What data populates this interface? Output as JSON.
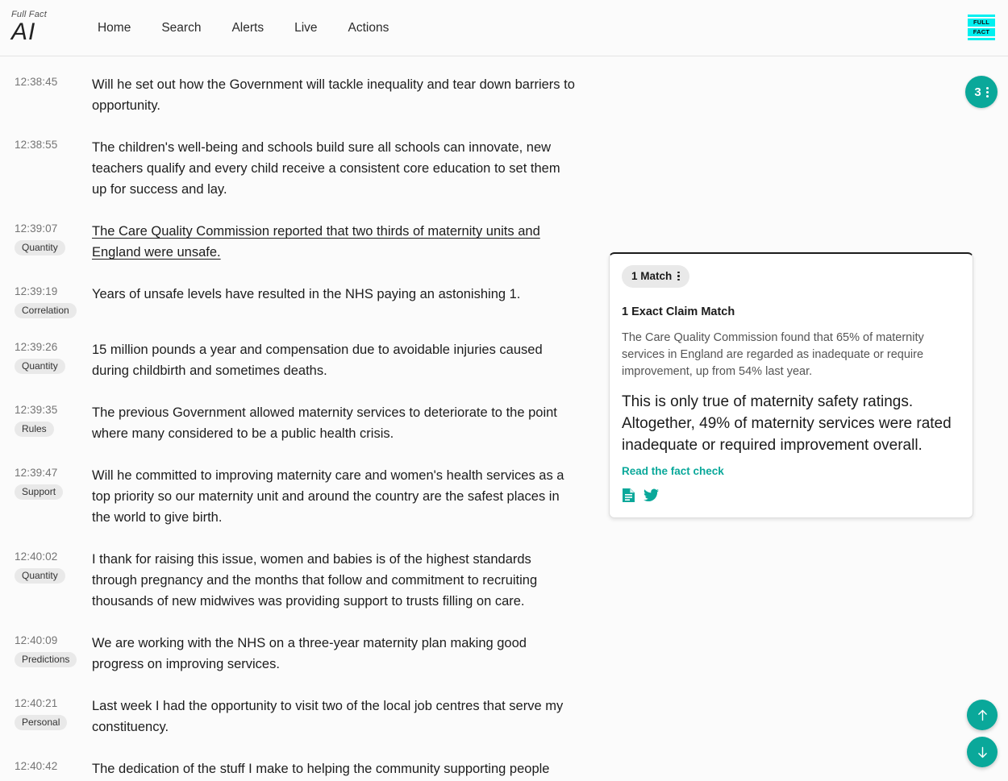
{
  "header": {
    "brand_sup": "Full Fact",
    "brand_name": "AI",
    "nav": [
      {
        "label": "Home"
      },
      {
        "label": "Search"
      },
      {
        "label": "Alerts"
      },
      {
        "label": "Live"
      },
      {
        "label": "Actions"
      }
    ],
    "logo": {
      "line1": "FULL",
      "line2": "FACT",
      "color": "#00f0f0"
    }
  },
  "counter": {
    "value": "3",
    "menu_icon": "kebab-menu-icon"
  },
  "transcript": [
    {
      "time": "12:38:45",
      "tag": "",
      "text": "Will he set out how the Government will tackle inequality and tear down barriers to opportunity.",
      "claim": false
    },
    {
      "time": "12:38:55",
      "tag": "",
      "text": "The children's well-being and schools build sure all schools can innovate, new teachers qualify and every child receive a consistent core education to set them up for success and lay.",
      "claim": false
    },
    {
      "time": "12:39:07",
      "tag": "Quantity",
      "text": "The Care Quality Commission reported that two thirds of maternity units and England were unsafe.",
      "claim": true
    },
    {
      "time": "12:39:19",
      "tag": "Correlation",
      "text": "Years of unsafe levels have resulted in the NHS paying an astonishing 1.",
      "claim": false
    },
    {
      "time": "12:39:26",
      "tag": "Quantity",
      "text": "15 million pounds a year and compensation due to avoidable injuries caused during childbirth and sometimes deaths.",
      "claim": false
    },
    {
      "time": "12:39:35",
      "tag": "Rules",
      "text": "The previous Government allowed maternity services to deteriorate to the point where many considered to be a public health crisis.",
      "claim": false
    },
    {
      "time": "12:39:47",
      "tag": "Support",
      "text": "Will he committed to improving maternity care and women's health services as a top priority so our maternity unit and around the country are the safest places in the world to give birth.",
      "claim": false
    },
    {
      "time": "12:40:02",
      "tag": "Quantity",
      "text": "I thank for raising this issue, women and babies is of the highest standards through pregnancy and the months that follow and commitment to recruiting thousands of new midwives was providing support to trusts filling on care.",
      "claim": false
    },
    {
      "time": "12:40:09",
      "tag": "Predictions",
      "text": "We are working with the NHS on a three-year maternity plan making good progress on improving services.",
      "claim": false
    },
    {
      "time": "12:40:21",
      "tag": "Personal",
      "text": "Last week I had the opportunity to visit two of the local job centres that serve my constituency.",
      "claim": false
    },
    {
      "time": "12:40:42",
      "tag": "",
      "text": "The dedication of the stuff I make to helping the community supporting people",
      "claim": false
    }
  ],
  "match_card": {
    "badge_label": "1 Match",
    "badge_menu_icon": "kebab-menu-icon",
    "heading": "1 Exact Claim Match",
    "claim_text": "The Care Quality Commission found that 65% of maternity services in England are regarded as inadequate or require improvement, up from 54% last year.",
    "verdict_text": "This is only true of maternity safety ratings. Altogether, 49% of maternity services were rated inadequate or required improvement overall.",
    "link_label": "Read the fact check",
    "actions": [
      {
        "icon": "article-document-icon"
      },
      {
        "icon": "twitter-bird-icon"
      }
    ]
  },
  "floating_controls": [
    {
      "icon": "arrow-up-icon"
    },
    {
      "icon": "arrow-down-icon"
    }
  ],
  "colors": {
    "accent": "#0aa89a",
    "brand_cyan": "#00f0f0",
    "tag_bg": "#e9e9e9",
    "page_bg": "#fbfbfb"
  }
}
